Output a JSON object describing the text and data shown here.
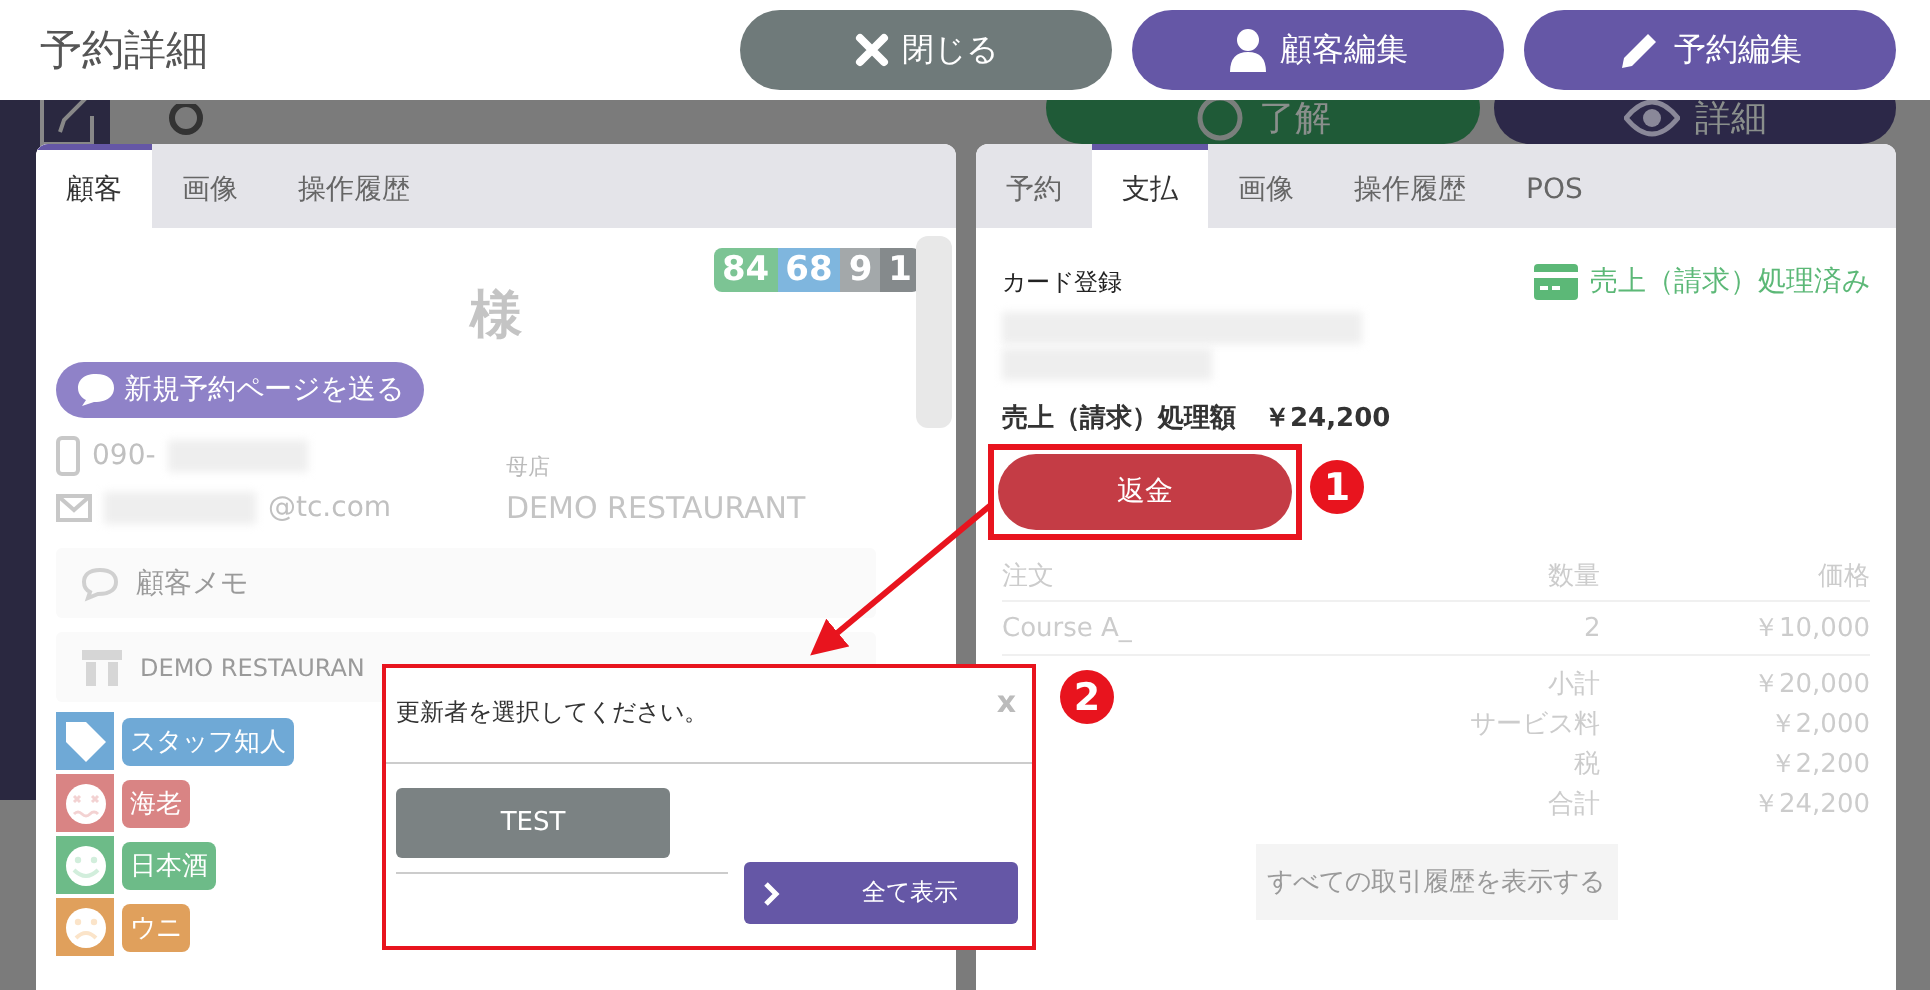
{
  "header": {
    "title": "予約詳細",
    "buttons": [
      {
        "kind": "close",
        "label": "閉じる"
      },
      {
        "kind": "customer",
        "label": "顧客編集"
      },
      {
        "kind": "edit",
        "label": "予約編集"
      }
    ]
  },
  "background": {
    "buttons": [
      {
        "kind": "ok",
        "label": "了解"
      },
      {
        "kind": "detail",
        "label": "詳細"
      }
    ]
  },
  "customer_panel": {
    "tabs": [
      {
        "label": "顧客",
        "selected": true
      },
      {
        "label": "画像",
        "selected": false
      },
      {
        "label": "操作履歴",
        "selected": false
      }
    ],
    "badges": [
      {
        "value": "84",
        "color": "#7cc494"
      },
      {
        "value": "68",
        "color": "#7fb6de"
      },
      {
        "value": "9",
        "color": "#a3a8aa"
      },
      {
        "value": "1",
        "color": "#858a8c"
      }
    ],
    "honorific": "様",
    "send_button": "新規予約ページを送る",
    "phone_prefix": "090-",
    "home_store_label": "母店",
    "home_store": "DEMO RESTAURANT",
    "email_domain": "@tc.com",
    "memo_label": "顧客メモ",
    "store_label": "DEMO RESTAURAN",
    "tags": [
      {
        "kind": "tag",
        "label": "スタッフ知人",
        "color": "#6fa9d6"
      },
      {
        "kind": "dizzy",
        "label": "海老",
        "color": "#d98484"
      },
      {
        "kind": "smile",
        "label": "日本酒",
        "color": "#6dbb88"
      },
      {
        "kind": "frown",
        "label": "ウニ",
        "color": "#e0a05c"
      }
    ]
  },
  "payment_panel": {
    "tabs": [
      {
        "label": "予約",
        "selected": false
      },
      {
        "label": "支払",
        "selected": true
      },
      {
        "label": "画像",
        "selected": false
      },
      {
        "label": "操作履歴",
        "selected": false
      },
      {
        "label": "POS",
        "selected": false
      }
    ],
    "card_label": "カード登録",
    "status": "売上（請求）処理済み",
    "amount_label": "売上（請求）処理額",
    "amount": "￥24,200",
    "refund_button": "返金",
    "order_table": {
      "columns": [
        "注文",
        "数量",
        "価格"
      ],
      "rows": [
        {
          "item": "Course A_",
          "quantity": "2",
          "price": "￥10,000"
        }
      ]
    },
    "summary": [
      {
        "label": "小計",
        "value": "￥20,000"
      },
      {
        "label": "サービス料",
        "value": "￥2,000"
      },
      {
        "label": "税",
        "value": "￥2,200"
      },
      {
        "label": "合計",
        "value": "￥24,200"
      }
    ],
    "history_button": "すべての取引履歴を表示する"
  },
  "dialog": {
    "message": "更新者を選択してください。",
    "close": "x",
    "staff": [
      {
        "label": "TEST"
      }
    ],
    "show_all_button": "全て表示"
  },
  "annotations": [
    {
      "number": "1"
    },
    {
      "number": "2"
    }
  ]
}
